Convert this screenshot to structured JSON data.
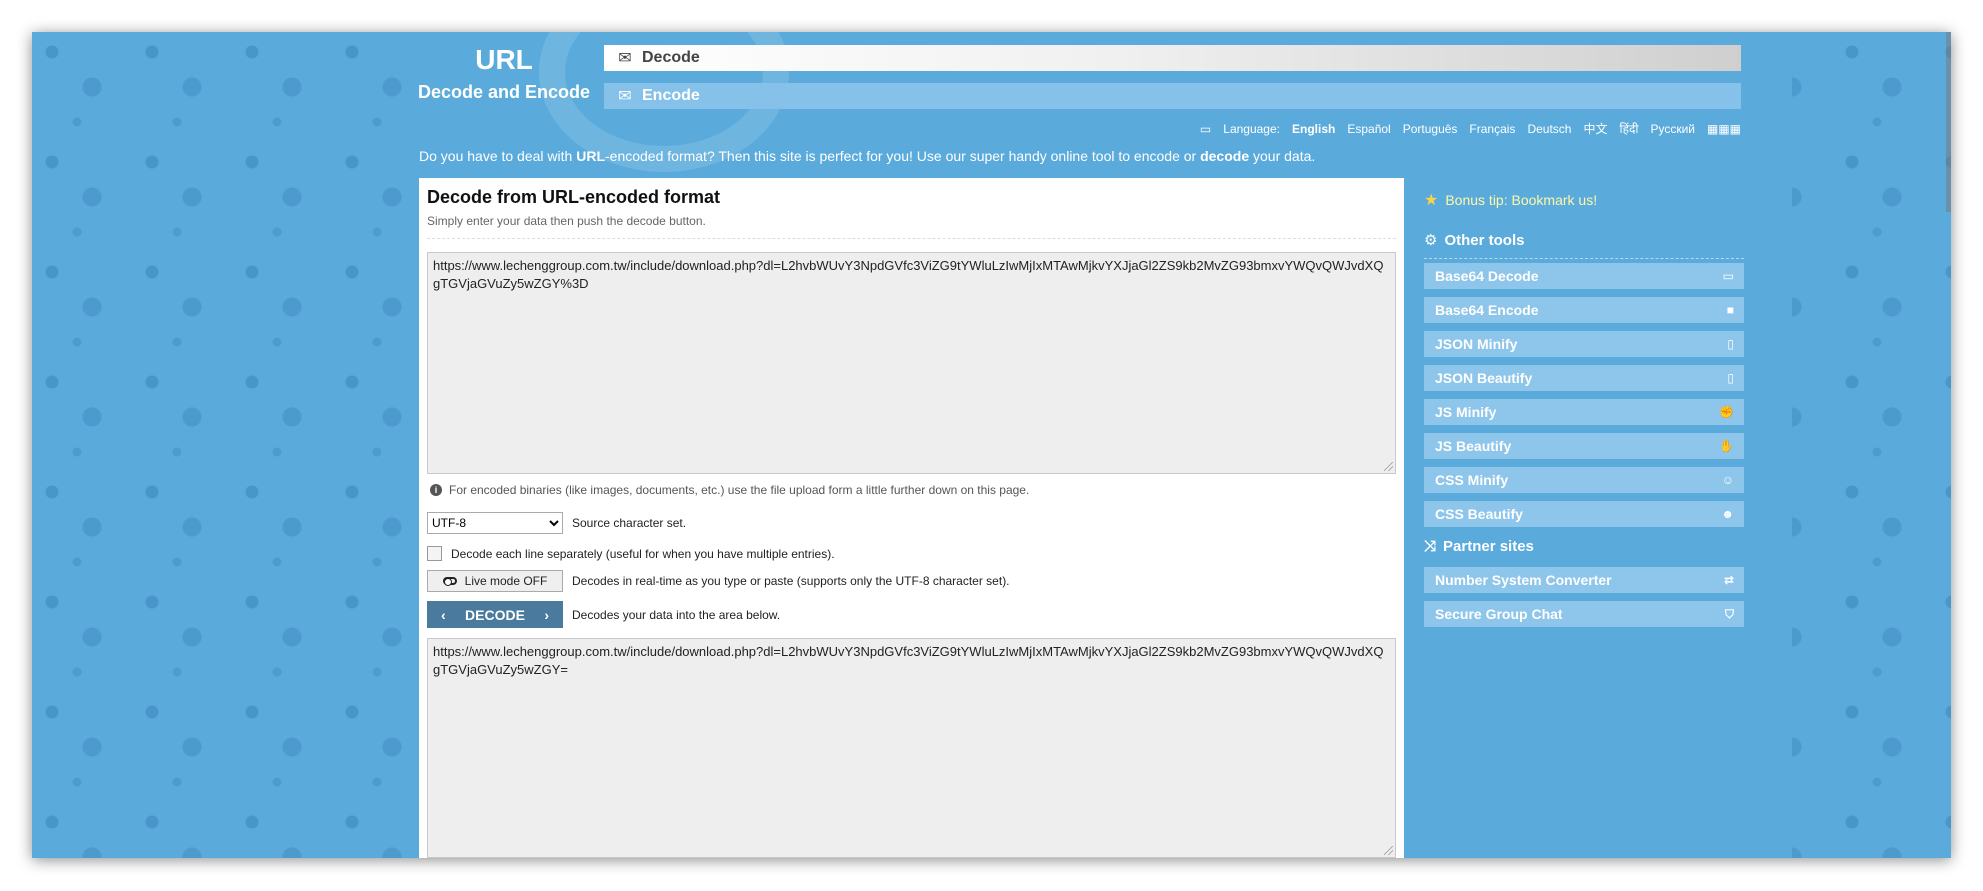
{
  "logo": {
    "line1": "URL",
    "line2": "Decode and Encode"
  },
  "nav": {
    "decode": {
      "label": "Decode",
      "icon": "envelope-open-icon"
    },
    "encode": {
      "label": "Encode",
      "icon": "envelope-icon"
    }
  },
  "language": {
    "label": "Language:",
    "items": [
      "English",
      "Español",
      "Português",
      "Français",
      "Deutsch",
      "中文",
      "हिंदी",
      "Русский"
    ],
    "active": "English"
  },
  "intro": {
    "part1": "Do you have to deal with ",
    "bold1": "URL",
    "part2": "-encoded format? Then this site is perfect for you! Use our super handy online tool to encode or ",
    "bold2": "decode",
    "part3": " your data."
  },
  "main": {
    "title": "Decode from URL-encoded format",
    "subtitle": "Simply enter your data then push the decode button.",
    "input_value": "https://www.lechenggroup.com.tw/include/download.php?dl=L2hvbWUvY3NpdGVfc3ViZG9tYWluLzIwMjIxMTAwMjkvYXJjaGl2ZS9kb2MvZG93bmxvYWQvQWJvdXQgTGVjaGVuZy5wZGY%3D",
    "binary_note": "For encoded binaries (like images, documents, etc.) use the file upload form a little further down on this page.",
    "charset_value": "UTF-8",
    "charset_label": "Source character set.",
    "line_separately_label": "Decode each line separately (useful for when you have multiple entries).",
    "live_mode_label": "Live mode OFF",
    "live_mode_desc": "Decodes in real-time as you type or paste (supports only the UTF-8 character set).",
    "decode_button": "DECODE",
    "decode_desc": "Decodes your data into the area below.",
    "output_value": "https://www.lechenggroup.com.tw/include/download.php?dl=L2hvbWUvY3NpdGVfc3ViZG9tYWluLzIwMjIxMTAwMjkvYXJjaGl2ZS9kb2MvZG93bmxvYWQvQWJvdXQgTGVjaGVuZy5wZGY="
  },
  "sidebar": {
    "tip": "Bonus tip: Bookmark us!",
    "other_tools_title": "Other tools",
    "other_tools": [
      {
        "label": "Base64 Decode",
        "icon": "folder-open-icon"
      },
      {
        "label": "Base64 Encode",
        "icon": "folder-icon"
      },
      {
        "label": "JSON Minify",
        "icon": "file-icon"
      },
      {
        "label": "JSON Beautify",
        "icon": "file-code-icon"
      },
      {
        "label": "JS Minify",
        "icon": "hand-fist-icon"
      },
      {
        "label": "JS Beautify",
        "icon": "hand-icon"
      },
      {
        "label": "CSS Minify",
        "icon": "smile-icon"
      },
      {
        "label": "CSS Beautify",
        "icon": "smile-icon"
      }
    ],
    "partner_title": "Partner sites",
    "partners": [
      {
        "label": "Number System Converter",
        "icon": "exchange-icon"
      },
      {
        "label": "Secure Group Chat",
        "icon": "shield-icon"
      }
    ]
  },
  "colors": {
    "background": "#5aabdc",
    "nav_encode": "#85c1e8",
    "side_item": "#8ec5ea",
    "decode_button": "#4a7a9e",
    "tip_text": "#fff7a8"
  }
}
